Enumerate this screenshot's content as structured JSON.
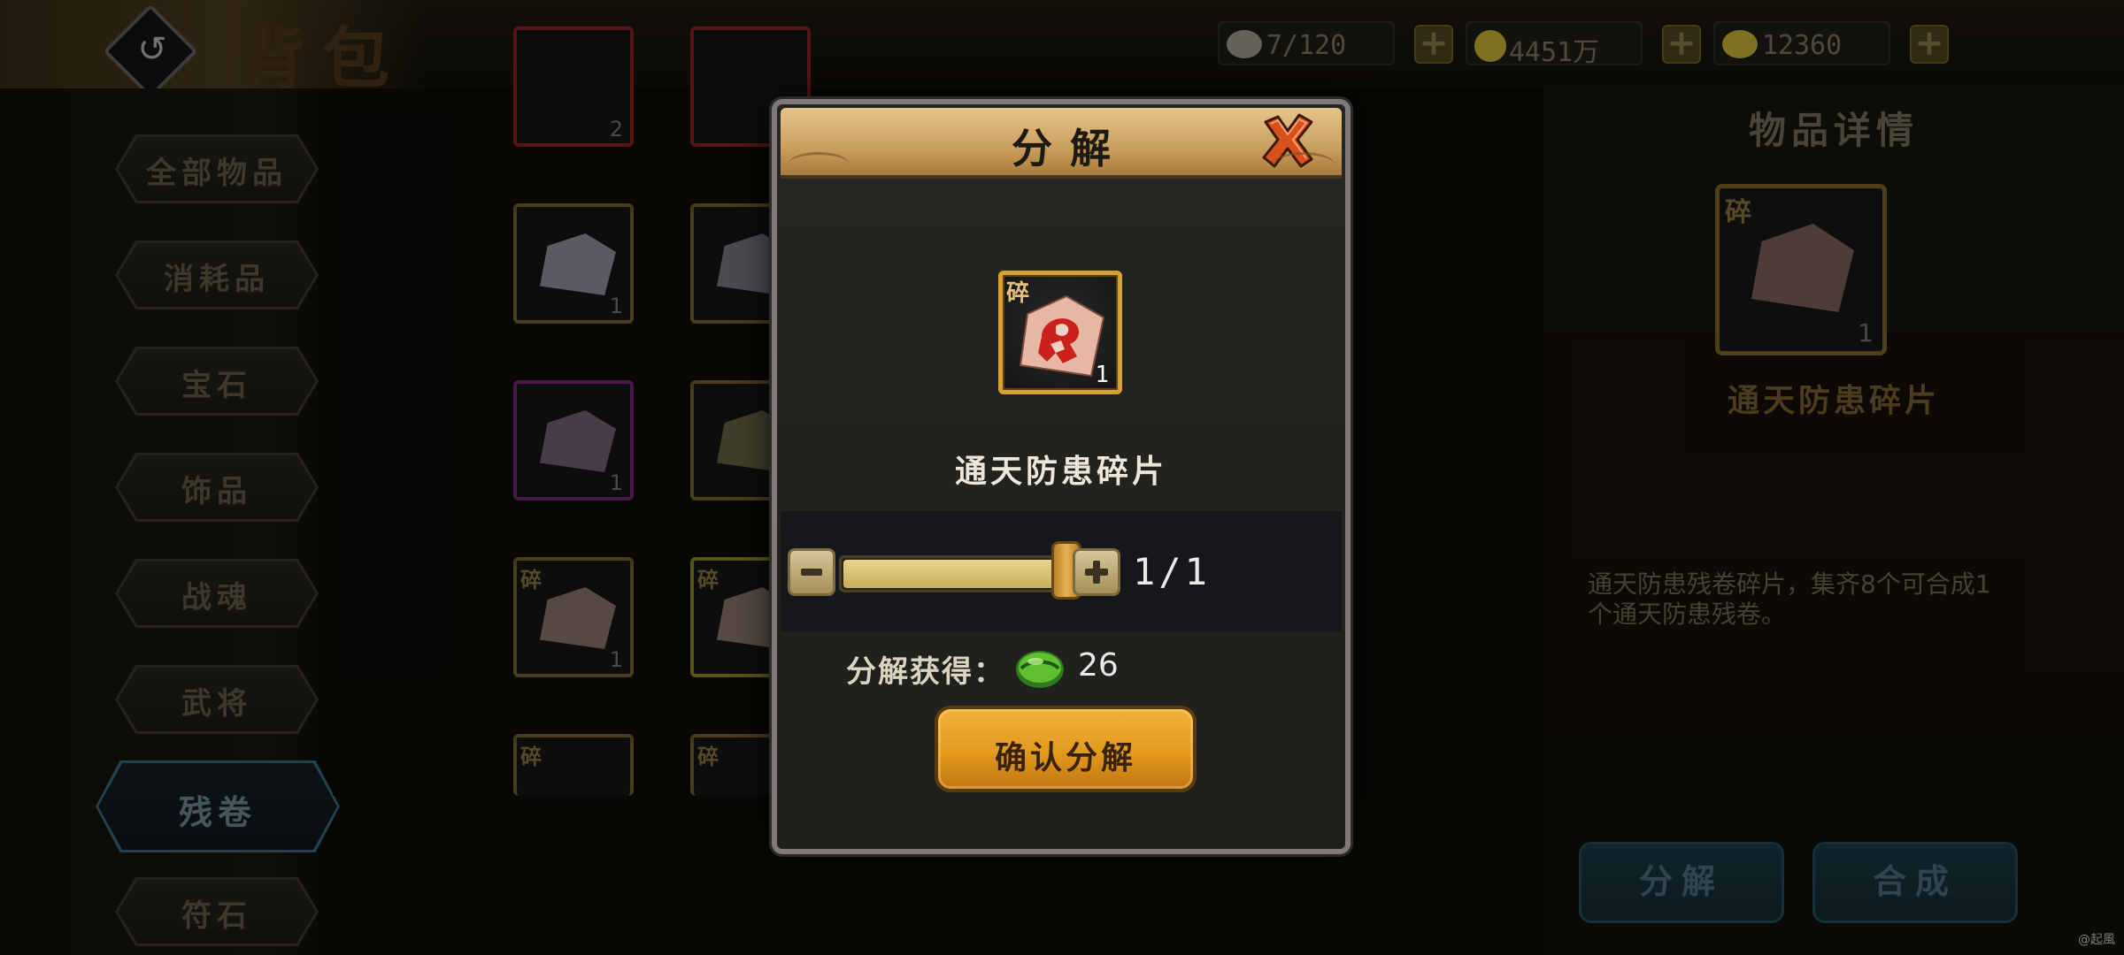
{
  "header": {
    "title": "背包",
    "resources": [
      {
        "icon": "stone-icon",
        "value": "7/120",
        "color": "#7a7770"
      },
      {
        "icon": "coin-icon",
        "value": "4451万",
        "color": "#9c8a2a"
      },
      {
        "icon": "ingot-icon",
        "value": "12360",
        "color": "#9c8a2a"
      }
    ]
  },
  "sidebar": {
    "items": [
      {
        "label": "全部物品",
        "active": false
      },
      {
        "label": "消耗品",
        "active": false
      },
      {
        "label": "宝石",
        "active": false
      },
      {
        "label": "饰品",
        "active": false
      },
      {
        "label": "战魂",
        "active": false
      },
      {
        "label": "武将",
        "active": false
      },
      {
        "label": "残卷",
        "active": true
      },
      {
        "label": "符石",
        "active": false
      }
    ]
  },
  "grid": {
    "cells": [
      {
        "count": "2",
        "tag": "",
        "kind": "partial-red"
      },
      {
        "count": "",
        "tag": "",
        "kind": "partial"
      },
      {
        "count": "1",
        "tag": "",
        "kind": "white"
      },
      {
        "count": "",
        "tag": "",
        "kind": "white"
      },
      {
        "count": "1",
        "tag": "",
        "kind": "purple"
      },
      {
        "count": "",
        "tag": "",
        "kind": "yellow"
      },
      {
        "count": "1",
        "tag": "碎",
        "kind": "red"
      },
      {
        "count": "",
        "tag": "碎",
        "kind": "red"
      },
      {
        "count": "",
        "tag": "碎",
        "kind": "red"
      },
      {
        "count": "",
        "tag": "碎",
        "kind": "red"
      }
    ]
  },
  "detail": {
    "title": "物品详情",
    "fragment_tag": "碎",
    "count": "1",
    "item_name": "通天防患碎片",
    "description": "通天防患残卷碎片，集齐8个可合成1个通天防患残卷。",
    "decompose_label": "分解",
    "synthesize_label": "合成"
  },
  "modal": {
    "title": "分解",
    "fragment_tag": "碎",
    "item_count": "1",
    "item_name": "通天防患碎片",
    "quantity": "1/1",
    "slider_fraction": 1.0,
    "reward_label": "分解获得：",
    "reward_value": "26",
    "reward_icon": "jade-orb-icon",
    "confirm_label": "确认分解"
  },
  "watermark": "@起風"
}
